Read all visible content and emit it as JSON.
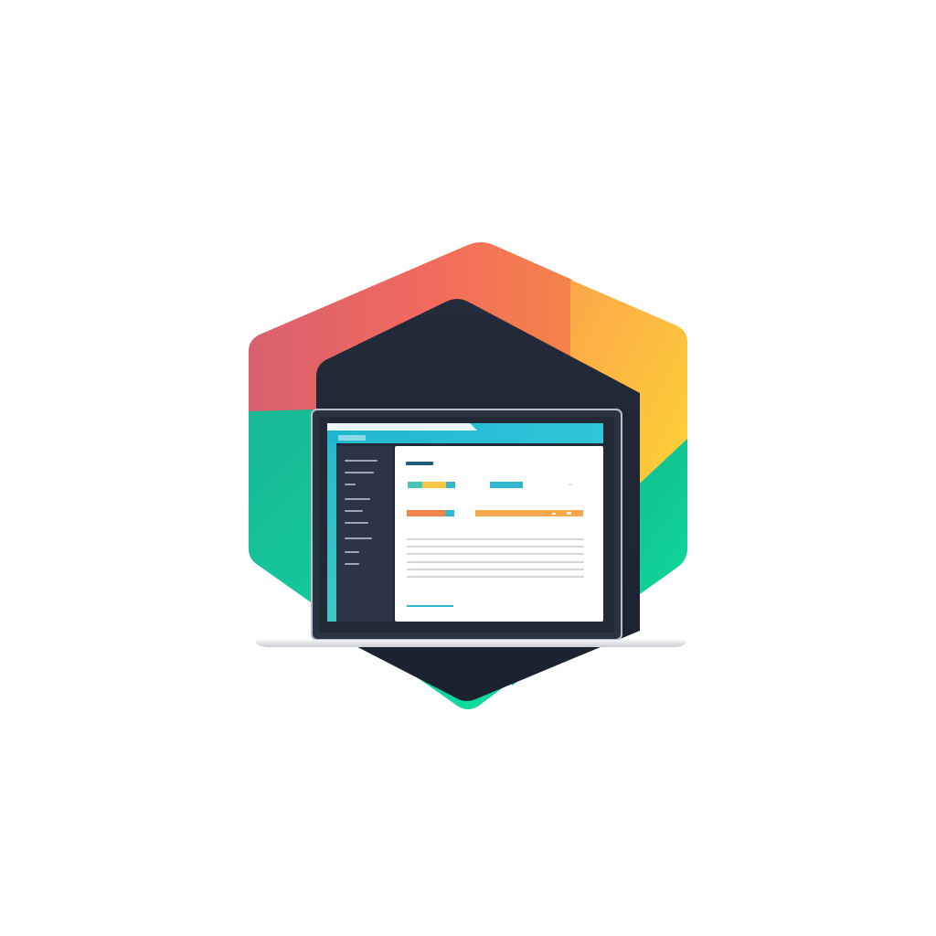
{
  "illustration": {
    "subject": "laptop-dashboard-logo",
    "window_title_text": "",
    "colors": {
      "hex_red": "#e8606b",
      "hex_orange": "#f47a4c",
      "hex_yellow": "#fdd033",
      "hex_green": "#12d39a",
      "hex_teal": "#1aa98f",
      "dark_navy": "#1f2736",
      "screen_accent_teal": "#2bbcd4",
      "bar_yellow": "#f7c744",
      "bar_orange": "#f2854a",
      "panel_white": "#ffffff"
    },
    "icons": [
      "hexagon-emblem",
      "laptop-icon",
      "dashboard-window",
      "sidebar-menu"
    ]
  }
}
